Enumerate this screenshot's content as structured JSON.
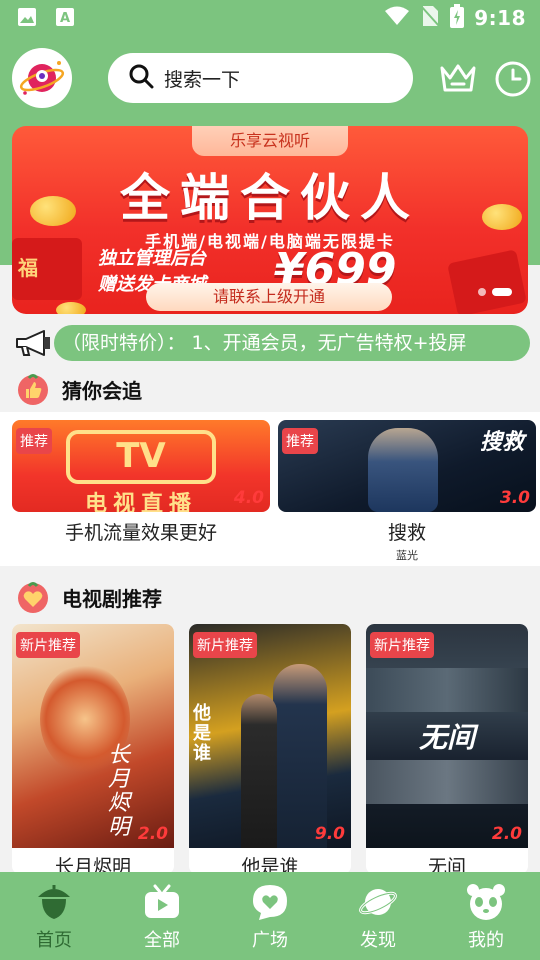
{
  "status": {
    "time": "9:18"
  },
  "header": {
    "search_placeholder": "搜索一下"
  },
  "banner": {
    "tab": "乐享云视听",
    "title": "全端合伙人",
    "subtitle": "手机端/电视端/电脑端无限提卡",
    "line1": "独立管理后台",
    "line2": "赠送发卡商城",
    "price": "¥699",
    "cta": "请联系上级开通",
    "sticker": "福"
  },
  "notice": {
    "text": "（限时特价）：  1、开通会员，无广告特权+投屏"
  },
  "guess": {
    "title": "猜你会追",
    "items": [
      {
        "title": "手机流量效果更好",
        "subtitle": "",
        "tag": "推荐",
        "score": "4.0",
        "poster_text_top": "TV",
        "poster_text_bottom": "电视直播"
      },
      {
        "title": "搜救",
        "subtitle": "蓝光",
        "tag": "推荐",
        "score": "3.0",
        "poster_text": "搜救"
      }
    ]
  },
  "drama": {
    "title": "电视剧推荐",
    "items": [
      {
        "title": "长月烬明",
        "tag": "新片推荐",
        "score": "2.0",
        "poster_text": "长月烬明"
      },
      {
        "title": "他是谁",
        "tag": "新片推荐",
        "score": "9.0",
        "poster_text": "他是谁"
      },
      {
        "title": "无间",
        "tag": "新片推荐",
        "score": "2.0",
        "poster_text": "无间"
      }
    ]
  },
  "nav": {
    "items": [
      {
        "label": "首页",
        "icon": "acorn-icon",
        "active": true
      },
      {
        "label": "全部",
        "icon": "tv-icon",
        "active": false
      },
      {
        "label": "广场",
        "icon": "chat-heart-icon",
        "active": false
      },
      {
        "label": "发现",
        "icon": "planet-icon",
        "active": false
      },
      {
        "label": "我的",
        "icon": "panda-icon",
        "active": false
      }
    ]
  },
  "colors": {
    "primary": "#7cc47f",
    "tag": "#e9454a",
    "score": "#ff3b3b"
  }
}
